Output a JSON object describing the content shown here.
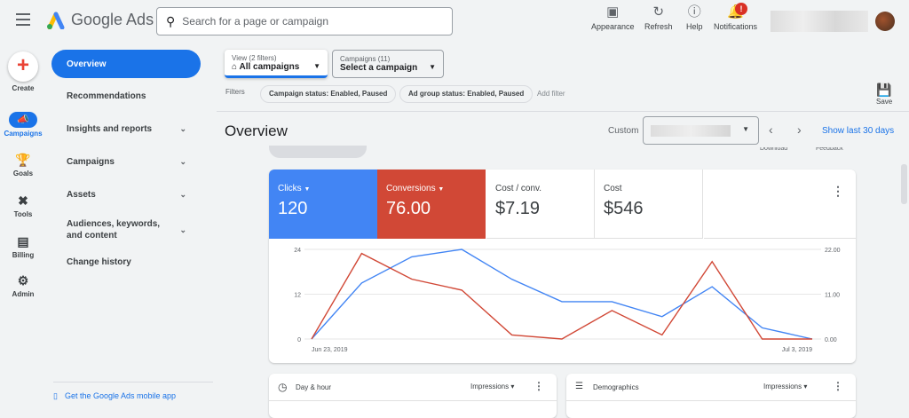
{
  "header": {
    "app_name": "Google Ads",
    "search_placeholder": "Search for a page or campaign",
    "buttons": [
      {
        "label": "Appearance",
        "icon": "appearance-icon"
      },
      {
        "label": "Refresh",
        "icon": "refresh-icon"
      },
      {
        "label": "Help",
        "icon": "help-icon"
      },
      {
        "label": "Notifications",
        "icon": "bell-icon"
      }
    ],
    "notification_badge": "!"
  },
  "rail": {
    "items": [
      {
        "label": "Create"
      },
      {
        "label": "Campaigns"
      },
      {
        "label": "Goals"
      },
      {
        "label": "Tools"
      },
      {
        "label": "Billing"
      },
      {
        "label": "Admin"
      }
    ]
  },
  "nav": {
    "items": [
      {
        "label": "Overview"
      },
      {
        "label": "Recommendations"
      },
      {
        "label": "Insights and reports"
      },
      {
        "label": "Campaigns"
      },
      {
        "label": "Assets"
      },
      {
        "label": "Audiences, keywords, and content"
      },
      {
        "label": "Change history"
      }
    ],
    "mobile_link": "Get the Google Ads mobile app"
  },
  "filters": {
    "view_label": "View (2 filters)",
    "view_value": "All campaigns",
    "campaigns_label": "Campaigns (11)",
    "campaigns_value": "Select a campaign",
    "filters_label": "Filters",
    "chips": [
      "Campaign status: Enabled, Paused",
      "Ad group status: Enabled, Paused"
    ],
    "add_filter": "Add filter",
    "save": "Save"
  },
  "overview": {
    "title": "Overview",
    "date_mode": "Custom",
    "show_last": "Show last 30 days",
    "download": "Download",
    "feedback": "Feedback"
  },
  "metrics": [
    {
      "label": "Clicks",
      "value": "120",
      "color": "#4285f4"
    },
    {
      "label": "Conversions",
      "value": "76.00",
      "color": "#d14836"
    },
    {
      "label": "Cost / conv.",
      "value": "$7.19"
    },
    {
      "label": "Cost",
      "value": "$546"
    }
  ],
  "chart_data": {
    "type": "line",
    "x": [
      "Jun 23, 2019",
      "Jun 24, 2019",
      "Jun 25, 2019",
      "Jun 26, 2019",
      "Jun 27, 2019",
      "Jun 28, 2019",
      "Jun 29, 2019",
      "Jun 30, 2019",
      "Jul 1, 2019",
      "Jul 2, 2019",
      "Jul 3, 2019"
    ],
    "x_tick_labels": [
      "Jun 23, 2019",
      "Jul 3, 2019"
    ],
    "left_ticks": [
      "0",
      "12",
      "24"
    ],
    "right_ticks": [
      "0.00",
      "11.00",
      "22.00"
    ],
    "ylim_left": [
      0,
      24
    ],
    "ylim_right": [
      0,
      22
    ],
    "series": [
      {
        "name": "Clicks",
        "axis": "left",
        "color": "#4285f4",
        "values": [
          0,
          15,
          22,
          24,
          16,
          10,
          10,
          6,
          14,
          3,
          0
        ]
      },
      {
        "name": "Conversions",
        "axis": "right",
        "color": "#d14836",
        "values": [
          0,
          21,
          14.7,
          12,
          1,
          0,
          7,
          1,
          19,
          0,
          0
        ]
      }
    ]
  },
  "bottom_cards": [
    {
      "title": "Day & hour",
      "metric": "Impressions"
    },
    {
      "title": "Demographics",
      "metric": "Impressions"
    }
  ]
}
